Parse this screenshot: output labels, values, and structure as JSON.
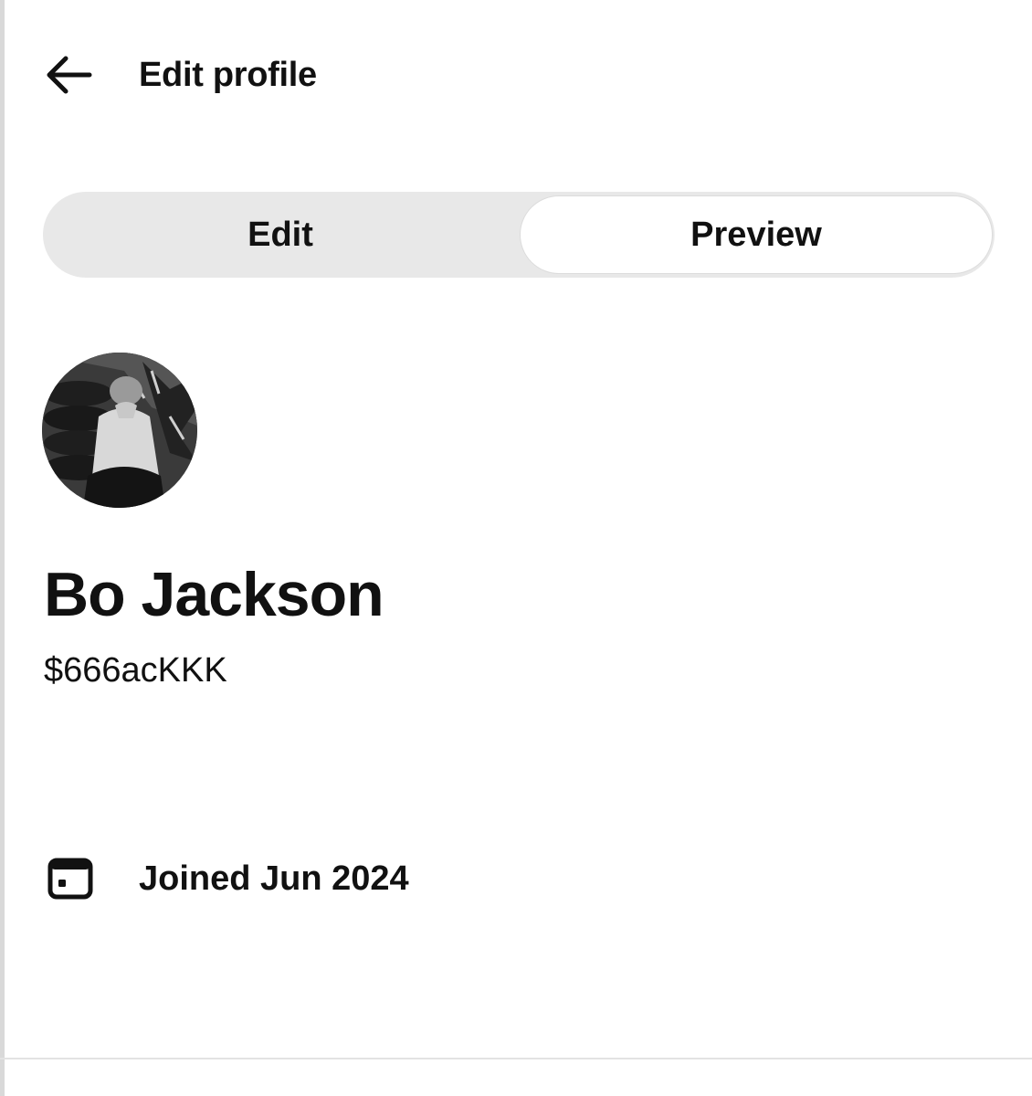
{
  "header": {
    "title": "Edit profile",
    "back_icon": "arrow-left-icon"
  },
  "tabs": [
    {
      "label": "Edit",
      "selected": false
    },
    {
      "label": "Preview",
      "selected": true
    }
  ],
  "profile": {
    "name": "Bo Jackson",
    "handle": "$666acKKK",
    "joined": "Joined Jun 2024",
    "joined_icon": "calendar-icon"
  },
  "colors": {
    "text": "#111111",
    "segment_bg": "#e8e8e8",
    "segment_selected_bg": "#ffffff",
    "divider": "#e3e3e3"
  }
}
